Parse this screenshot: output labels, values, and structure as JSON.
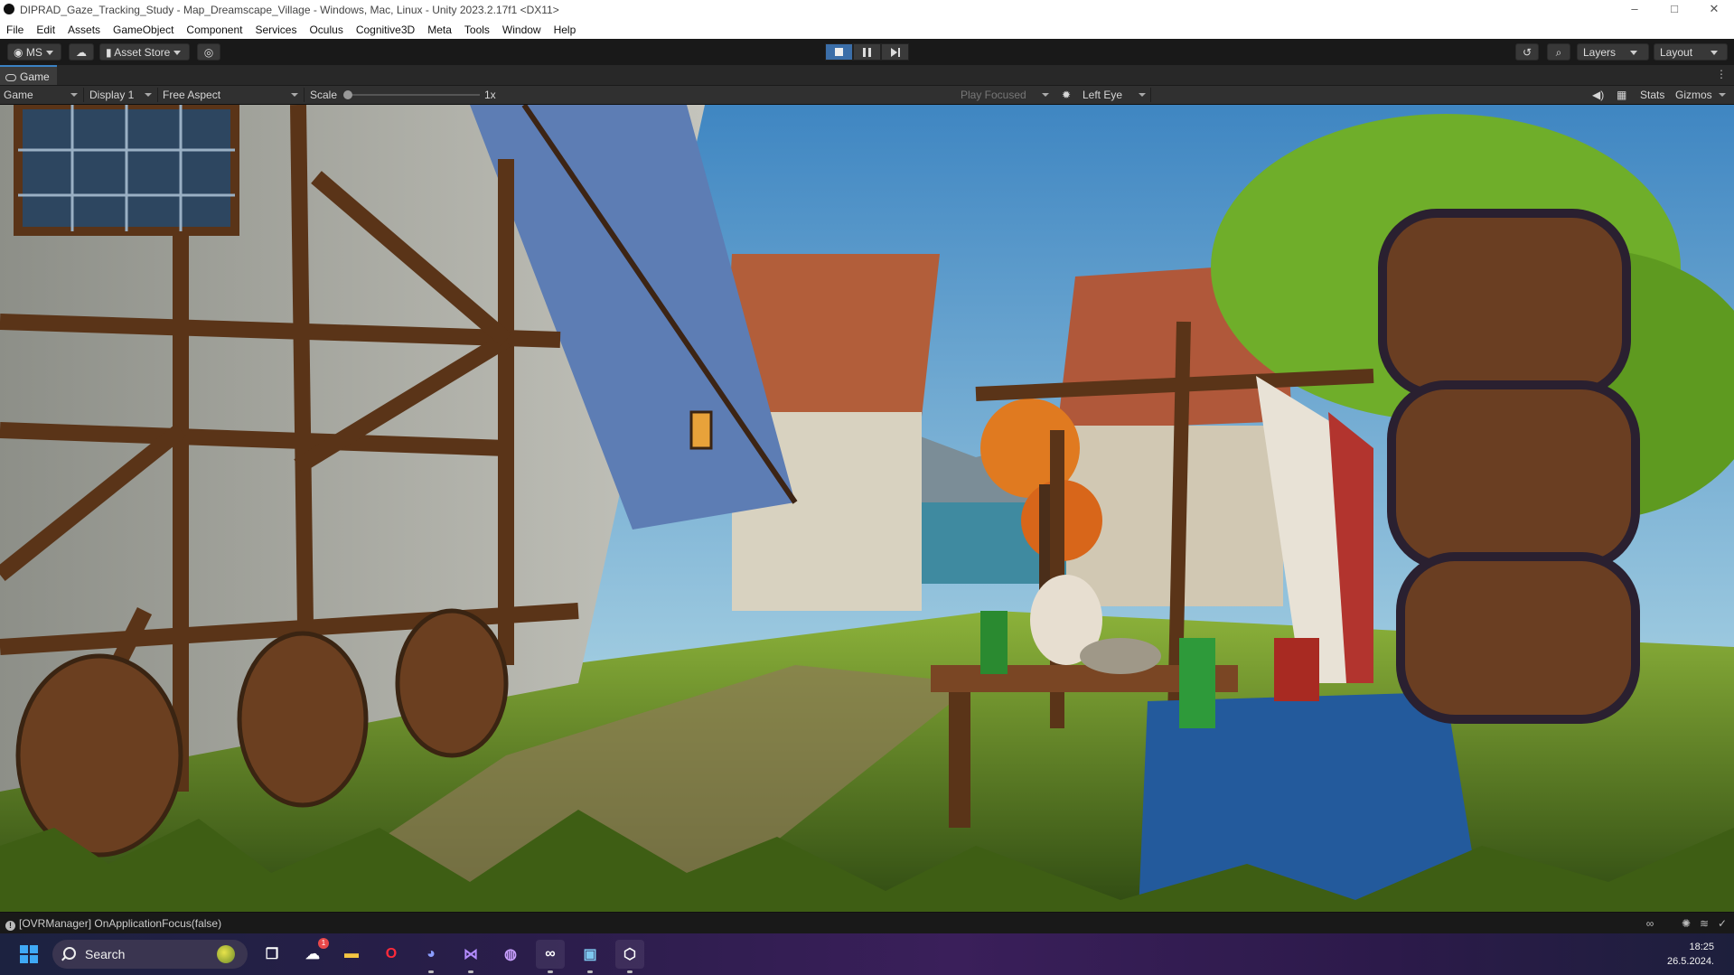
{
  "window": {
    "title": "DIPRAD_Gaze_Tracking_Study - Map_Dreamscape_Village - Windows, Mac, Linux - Unity 2023.2.17f1 <DX11>",
    "controls": [
      "–",
      "□",
      "✕"
    ]
  },
  "menu": [
    "File",
    "Edit",
    "Assets",
    "GameObject",
    "Component",
    "Services",
    "Oculus",
    "Cognitive3D",
    "Meta",
    "Tools",
    "Window",
    "Help"
  ],
  "toolbar": {
    "account_label": "MS",
    "asset_store_label": "Asset Store",
    "layers_label": "Layers",
    "layout_label": "Layout",
    "play_mode_active": true
  },
  "game_tab": {
    "label": "Game",
    "menu_glyph": "⋮"
  },
  "game_controls": {
    "view_mode": "Game",
    "display": "Display 1",
    "aspect": "Free Aspect",
    "scale_label": "Scale",
    "scale_value": "1x",
    "play_focused": "Play Focused",
    "eye": "Left Eye",
    "stats": "Stats",
    "gizmos": "Gizmos"
  },
  "status": {
    "message": "[OVRManager] OnApplicationFocus(false)"
  },
  "taskbar": {
    "search_label": "Search",
    "badge_count": "1",
    "time": "18:25",
    "date": "26.5.2024."
  },
  "colors": {
    "play_active": "#3b6ea8",
    "tab_accent": "#3b82c4",
    "sky_top": "#4a8fc9",
    "grass": "#6e9a2f"
  }
}
